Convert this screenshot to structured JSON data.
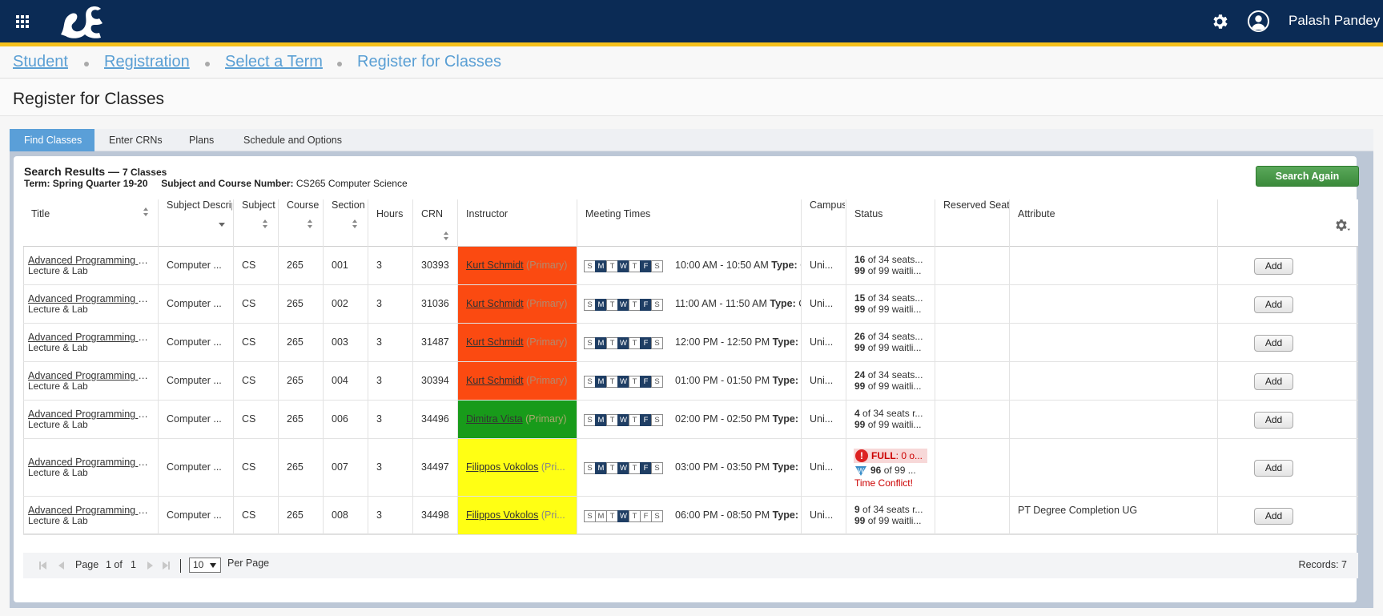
{
  "header": {
    "user_name": "Palash Pandey",
    "icons": [
      "apps-grid-icon",
      "dragon-logo",
      "gear-icon",
      "user-avatar-icon"
    ]
  },
  "breadcrumb": [
    "Student",
    "Registration",
    "Select a Term",
    "Register for Classes"
  ],
  "page_title": "Register for Classes",
  "tabs": [
    "Find Classes",
    "Enter CRNs",
    "Plans",
    "Schedule and Options"
  ],
  "results": {
    "title": "Search Results —",
    "count": "7 Classes",
    "term_label": "Term:",
    "term_value": "Spring Quarter 19-20",
    "subject_label": "Subject and Course Number:",
    "subject_value": "CS265 Computer Science",
    "search_again": "Search Again"
  },
  "columns": {
    "title": "Title",
    "subject_desc": "Subject Descrip",
    "subject": "Subject",
    "course": "Course I",
    "section": "Section",
    "hours": "Hours",
    "crn": "CRN",
    "instructor": "Instructor",
    "meeting": "Meeting Times",
    "campus": "Campus",
    "status": "Status",
    "reserved": "Reserved Seat",
    "attribute": "Attribute"
  },
  "rows": [
    {
      "title": "Advanced Programming T...",
      "sub": "Lecture & Lab",
      "desc": "Computer ...",
      "subject": "CS",
      "course": "265",
      "section": "001",
      "hours": "3",
      "crn": "30393",
      "instructor": "Kurt Schmidt",
      "role": "(Primary)",
      "time": "10:00 AM - 10:50 AM",
      "type_label": "Type:",
      "campus": "Uni...",
      "seats_num": "16",
      "seats_rest": "of 34 seats...",
      "wait_num": "99",
      "wait_rest": "of 99 waitli...",
      "attribute": "",
      "add": "Add"
    },
    {
      "title": "Advanced Programming T...",
      "sub": "Lecture & Lab",
      "desc": "Computer ...",
      "subject": "CS",
      "course": "265",
      "section": "002",
      "hours": "3",
      "crn": "31036",
      "instructor": "Kurt Schmidt",
      "role": "(Primary)",
      "time": "11:00 AM - 11:50 AM",
      "type_label": "Type:",
      "campus": "Uni...",
      "seats_num": "15",
      "seats_rest": "of 34 seats...",
      "wait_num": "99",
      "wait_rest": "of 99 waitli...",
      "attribute": "",
      "add": "Add"
    },
    {
      "title": "Advanced Programming T...",
      "sub": "Lecture & Lab",
      "desc": "Computer ...",
      "subject": "CS",
      "course": "265",
      "section": "003",
      "hours": "3",
      "crn": "31487",
      "instructor": "Kurt Schmidt",
      "role": "(Primary)",
      "time": "12:00 PM - 12:50 PM",
      "type_label": "Type:",
      "campus": "Uni...",
      "seats_num": "26",
      "seats_rest": "of 34 seats...",
      "wait_num": "99",
      "wait_rest": "of 99 waitli...",
      "attribute": "",
      "add": "Add"
    },
    {
      "title": "Advanced Programming T...",
      "sub": "Lecture & Lab",
      "desc": "Computer ...",
      "subject": "CS",
      "course": "265",
      "section": "004",
      "hours": "3",
      "crn": "30394",
      "instructor": "Kurt Schmidt",
      "role": "(Primary)",
      "time": "01:00 PM - 01:50 PM",
      "type_label": "Type:",
      "campus": "Uni...",
      "seats_num": "24",
      "seats_rest": "of 34 seats...",
      "wait_num": "99",
      "wait_rest": "of 99 waitli...",
      "attribute": "",
      "add": "Add"
    },
    {
      "title": "Advanced Programming T...",
      "sub": "Lecture & Lab",
      "desc": "Computer ...",
      "subject": "CS",
      "course": "265",
      "section": "006",
      "hours": "3",
      "crn": "34496",
      "instructor": "Dimitra Vista",
      "role": "(Primary)",
      "time": "02:00 PM - 02:50 PM",
      "type_label": "Type:",
      "campus": "Uni...",
      "seats_num": "4",
      "seats_rest": "of 34 seats r...",
      "wait_num": "99",
      "wait_rest": "of 99 waitli...",
      "attribute": "",
      "add": "Add"
    },
    {
      "title": "Advanced Programming T...",
      "sub": "Lecture & Lab",
      "desc": "Computer ...",
      "subject": "CS",
      "course": "265",
      "section": "007",
      "hours": "3",
      "crn": "34497",
      "instructor": "Filippos Vokolos",
      "role": "(Pri...",
      "time": "03:00 PM - 03:50 PM",
      "type_label": "Type:",
      "campus": "Uni...",
      "full_label": "FULL",
      "full_rest": ": 0 o...",
      "wait_num": "96",
      "wait_rest": "of 99 ...",
      "conflict": "Time Conflict!",
      "attribute": "",
      "add": "Add"
    },
    {
      "title": "Advanced Programming T...",
      "sub": "Lecture & Lab",
      "desc": "Computer ...",
      "subject": "CS",
      "course": "265",
      "section": "008",
      "hours": "3",
      "crn": "34498",
      "instructor": "Filippos Vokolos",
      "role": "(Pri...",
      "time": "06:00 PM - 08:50 PM",
      "type_label": "Type:",
      "campus": "Uni...",
      "seats_num": "9",
      "seats_rest": "of 34 seats r...",
      "wait_num": "99",
      "wait_rest": "of 99 waitli...",
      "attribute": "PT Degree Completion UG",
      "add": "Add"
    }
  ],
  "instructor_colors": [
    "#fb4a11",
    "#fb4a11",
    "#fb4a11",
    "#fb4a11",
    "#189b1a",
    "#ffff14",
    "#ffff14"
  ],
  "day_letters": [
    "S",
    "M",
    "T",
    "W",
    "T",
    "F",
    "S"
  ],
  "day_on": [
    [
      false,
      true,
      false,
      true,
      false,
      true,
      false
    ],
    [
      false,
      true,
      false,
      true,
      false,
      true,
      false
    ],
    [
      false,
      true,
      false,
      true,
      false,
      true,
      false
    ],
    [
      false,
      true,
      false,
      true,
      false,
      true,
      false
    ],
    [
      false,
      true,
      false,
      true,
      false,
      true,
      false
    ],
    [
      false,
      true,
      false,
      true,
      false,
      true,
      false
    ],
    [
      false,
      false,
      false,
      true,
      false,
      false,
      false
    ]
  ],
  "pager": {
    "page_label": "Page",
    "page_of": "1 of",
    "page_total": "1",
    "per_page_value": "10",
    "per_page_label": "Per Page",
    "records": "Records: 7"
  }
}
